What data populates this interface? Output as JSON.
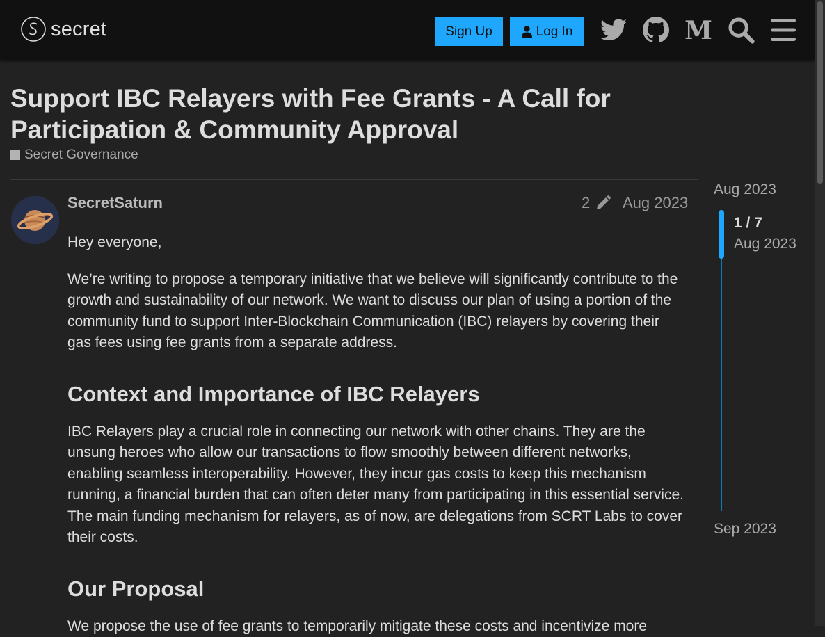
{
  "header": {
    "logo_text": "secret",
    "signup_label": "Sign Up",
    "login_label": "Log In",
    "icons": [
      "twitter-icon",
      "github-icon",
      "medium-icon",
      "search-icon",
      "menu-icon"
    ]
  },
  "topic": {
    "title": "Support IBC Relayers with Fee Grants - A Call for Participation & Community Approval",
    "category": "Secret Governance",
    "category_color": "#b3b3b3"
  },
  "post": {
    "username": "SecretSaturn",
    "edit_count": "2",
    "date": "Aug 2023",
    "greeting": "Hey everyone,",
    "paragraph1": "We’re writing to propose a temporary initiative that we believe will significantly contribute to the growth and sustainability of our network. We want to discuss our plan of using a portion of the community fund to support Inter-Blockchain Communication (IBC) relayers by covering their gas fees using fee grants from a separate address.",
    "heading1": "Context and Importance of IBC Relayers",
    "paragraph2": "IBC Relayers play a crucial role in connecting our network with other chains. They are the unsung heroes who allow our transactions to flow smoothly between different networks, enabling seamless interoperability. However, they incur gas costs to keep this mechanism running, a financial burden that can often deter many from participating in this essential service. The main funding mechanism for relayers, as of now, are delegations from SCRT Labs to cover their costs.",
    "heading2": "Our Proposal",
    "paragraph3": "We propose the use of fee grants to temporarily mitigate these costs and incentivize more"
  },
  "timeline": {
    "start_date": "Aug 2023",
    "position": "1 / 7",
    "position_date": "Aug 2023",
    "end_date": "Sep 2023"
  },
  "colors": {
    "background": "#222222",
    "header": "#111111",
    "accent": "#1ea7fd",
    "timeline": "#0b79ba"
  }
}
